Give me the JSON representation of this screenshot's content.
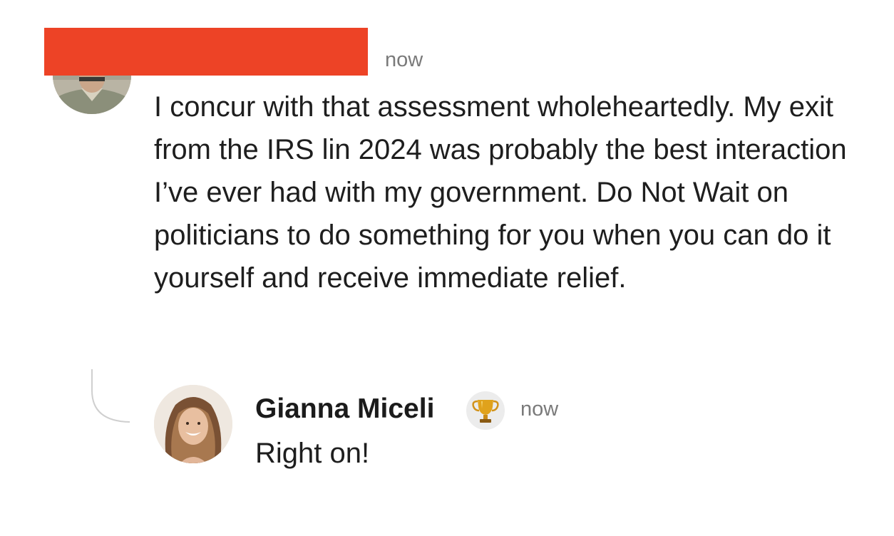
{
  "comment": {
    "timestamp": "now",
    "avatar_icon": "user-avatar-photo",
    "body": "I concur with that assessment wholeheartedly. My exit from the IRS lin 2024 was probably the best interaction I’ve ever had with my government. Do Not Wait on politicians to do something for you when you can do it yourself and receive immediate relief."
  },
  "reply": {
    "author": "Gianna Miceli",
    "badge_icon": "trophy-icon",
    "timestamp": "now",
    "body": "Right on!",
    "avatar_icon": "user-avatar-photo"
  },
  "colors": {
    "redaction": "#ed4326",
    "timestamp": "#7a7a7a",
    "text": "#1e1e1e",
    "thread_line": "#cfcfcf"
  }
}
